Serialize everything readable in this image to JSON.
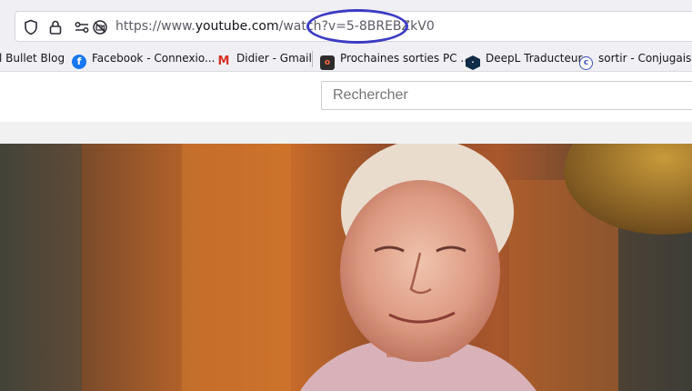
{
  "browser": {
    "url": {
      "prefix": "https://www.",
      "host": "youtube.com",
      "rest": "/watch?v=5-8BREBZkV0"
    },
    "icons": {
      "shield": "shield-icon",
      "lock": "lock-icon",
      "permissions": "permissions-icon",
      "camera_blocked": "camera-blocked-icon"
    },
    "annotation_color": "#3b3bc4"
  },
  "bookmarks": [
    {
      "label": "l Bullet Blog",
      "icon": ""
    },
    {
      "label": "Facebook - Connexio...",
      "icon": "facebook-icon"
    },
    {
      "label": "Didier - Gmail",
      "icon": "gmail-icon"
    },
    {
      "label": "Prochaines sorties PC ...",
      "icon": "site-icon"
    },
    {
      "label": "DeepL Traducteur",
      "icon": "deepl-icon"
    },
    {
      "label": "sortir - Conjugaison",
      "icon": "conjugaison-icon"
    }
  ],
  "youtube": {
    "search_placeholder": "Rechercher"
  }
}
